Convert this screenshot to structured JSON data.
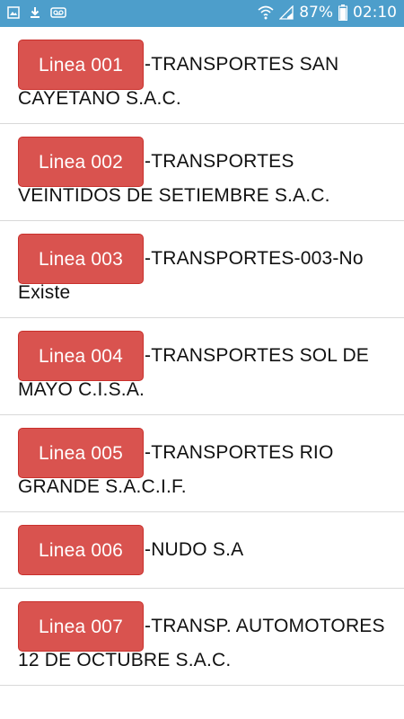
{
  "status_bar": {
    "battery": "87%",
    "time": "02:10",
    "left_icons": [
      "image-icon",
      "download-icon",
      "voicemail-icon"
    ],
    "right_icons": [
      "wifi-icon",
      "signal-icon",
      "battery-icon"
    ]
  },
  "lines": [
    {
      "badge": "Linea 001",
      "first": "-TRANSPORTES SAN",
      "second": "CAYETANO S.A.C."
    },
    {
      "badge": "Linea 002",
      "first": "-TRANSPORTES",
      "second": "VEINTIDOS DE SETIEMBRE S.A.C."
    },
    {
      "badge": "Linea 003",
      "first": "-TRANSPORTES-003-No",
      "second": "Existe"
    },
    {
      "badge": "Linea 004",
      "first": "-TRANSPORTES SOL DE",
      "second": "MAYO C.I.S.A."
    },
    {
      "badge": "Linea 005",
      "first": "-TRANSPORTES RIO",
      "second": "GRANDE S.A.C.I.F."
    },
    {
      "badge": "Linea 006",
      "first": "-NUDO S.A",
      "second": ""
    },
    {
      "badge": "Linea 007",
      "first": "-TRANSP. AUTOMOTORES",
      "second": "12 DE OCTUBRE S.A.C."
    }
  ],
  "colors": {
    "status_bar": "#4d9ecb",
    "badge": "#d9534f",
    "divider": "#d9d9d9"
  }
}
